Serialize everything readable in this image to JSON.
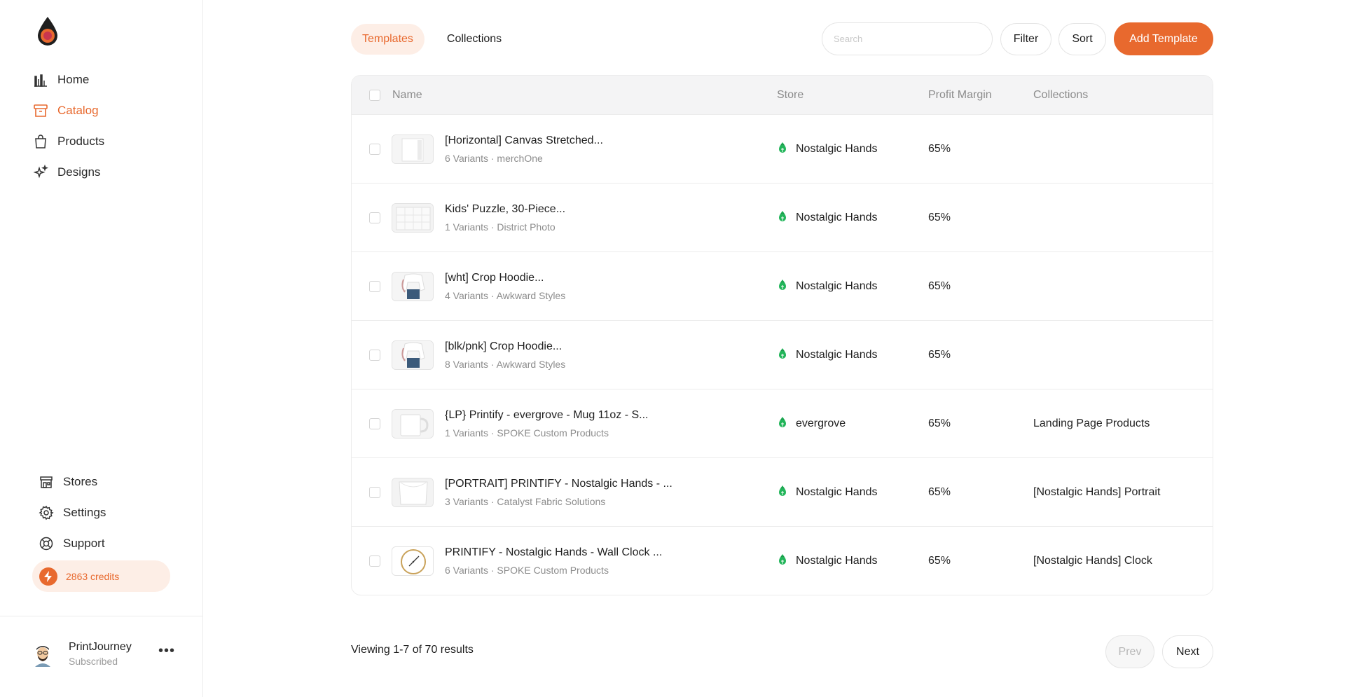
{
  "sidebar": {
    "nav": [
      {
        "label": "Home",
        "icon": "chart-icon",
        "active": false
      },
      {
        "label": "Catalog",
        "icon": "archive-icon",
        "active": true
      },
      {
        "label": "Products",
        "icon": "shopping-bag-icon",
        "active": false
      },
      {
        "label": "Designs",
        "icon": "sparkles-icon",
        "active": false
      }
    ],
    "bottom_nav": [
      {
        "label": "Stores",
        "icon": "storefront-icon"
      },
      {
        "label": "Settings",
        "icon": "gear-icon"
      },
      {
        "label": "Support",
        "icon": "lifebuoy-icon"
      }
    ],
    "credits": "2863 credits",
    "profile": {
      "name": "PrintJourney",
      "status": "Subscribed"
    }
  },
  "tabs": [
    {
      "label": "Templates",
      "active": true
    },
    {
      "label": "Collections",
      "active": false
    }
  ],
  "toolbar": {
    "search_placeholder": "Search",
    "filter_label": "Filter",
    "sort_label": "Sort",
    "add_label": "Add Template"
  },
  "table": {
    "headers": {
      "name": "Name",
      "store": "Store",
      "margin": "Profit Margin",
      "collections": "Collections"
    },
    "rows": [
      {
        "title": "[Horizontal] Canvas Stretched...",
        "sub": "6 Variants · merchOne",
        "store": "Nostalgic Hands",
        "margin": "65%",
        "collections": "",
        "thumb": "canvas"
      },
      {
        "title": "Kids' Puzzle, 30-Piece...",
        "sub": "1 Variants · District Photo",
        "store": "Nostalgic Hands",
        "margin": "65%",
        "collections": "",
        "thumb": "puzzle"
      },
      {
        "title": "[wht] Crop Hoodie...",
        "sub": "4 Variants · Awkward Styles",
        "store": "Nostalgic Hands",
        "margin": "65%",
        "collections": "",
        "thumb": "hoodie"
      },
      {
        "title": "[blk/pnk] Crop Hoodie...",
        "sub": "8 Variants · Awkward Styles",
        "store": "Nostalgic Hands",
        "margin": "65%",
        "collections": "",
        "thumb": "hoodie"
      },
      {
        "title": "{LP} Printify - evergrove - Mug 11oz - S...",
        "sub": "1 Variants · SPOKE Custom Products",
        "store": "evergrove",
        "margin": "65%",
        "collections": "Landing Page Products",
        "thumb": "mug"
      },
      {
        "title": "[PORTRAIT] PRINTIFY - Nostalgic Hands - ...",
        "sub": "3 Variants · Catalyst Fabric Solutions",
        "store": "Nostalgic Hands",
        "margin": "65%",
        "collections": "[Nostalgic Hands] Portrait",
        "thumb": "tapestry"
      },
      {
        "title": "PRINTIFY - Nostalgic Hands - Wall Clock ...",
        "sub": "6 Variants · SPOKE Custom Products",
        "store": "Nostalgic Hands",
        "margin": "65%",
        "collections": "[Nostalgic Hands] Clock",
        "thumb": "clock"
      }
    ]
  },
  "pagination": {
    "viewing": "Viewing 1-7 of 70 results",
    "prev_label": "Prev",
    "next_label": "Next"
  },
  "colors": {
    "accent": "#e8692e",
    "accent_bg": "#fdeee6",
    "store_icon": "#22b55a"
  }
}
